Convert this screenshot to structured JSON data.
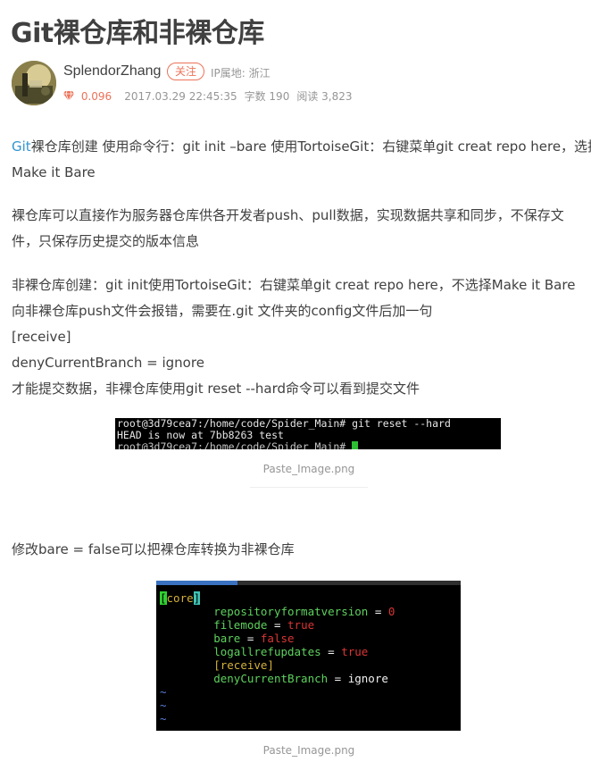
{
  "article": {
    "title": "Git裸仓库和非裸仓库",
    "author": "SplendorZhang",
    "follow_label": "关注",
    "ip_location": "IP属地: 浙江",
    "score": "0.096",
    "date": "2017.03.29 22:45:35",
    "word_count": "字数 190",
    "read_count": "阅读 3,823"
  },
  "content": {
    "p1_link": "Git",
    "p1_line1": "裸仓库创建 使用命令行：git init –bare 使用TortoiseGit：右键菜单git creat repo here，选择",
    "p1_line2": "Make it Bare",
    "p2_line1": "裸仓库可以直接作为服务器仓库供各开发者push、pull数据，实现数据共享和同步，不保存文",
    "p2_line2": "件，只保存历史提交的版本信息",
    "p3_lines": [
      "非裸仓库创建：git init使用TortoiseGit：右键菜单git creat repo here，不选择Make it Bare",
      "向非裸仓库push文件会报错，需要在.git 文件夹的config文件后加一句",
      "[receive]",
      "denyCurrentBranch = ignore",
      "才能提交数据，非裸仓库使用git reset --hard命令可以看到提交文件"
    ],
    "image1_caption": "Paste_Image.png",
    "p4": "修改bare = false可以把裸仓库转换为非裸仓库",
    "image2_caption": "Paste_Image.png"
  },
  "terminal1": {
    "line1": "root@3d79cea7:/home/code/Spider_Main# git reset --hard",
    "line2": "HEAD is now at 7bb8263 test",
    "line3": "root@3d79cea7:/home/code/Spider_Main# "
  },
  "terminal2": {
    "bracket_open": "[",
    "section": "core",
    "bracket_close": "]",
    "k1": "repositoryformatversion",
    "eq1": " = ",
    "v1": "0",
    "k2": "filemode",
    "eq2": " = ",
    "v2": "true",
    "k3": "bare",
    "eq3": " = ",
    "v3": "false",
    "k4": "logallrefupdates",
    "eq4": " = ",
    "v4": "true",
    "k5": "[receive]",
    "k6": "denyCurrentBranch",
    "eq6": " = ",
    "v6": "ignore",
    "tilde": "~"
  },
  "colors": {
    "accent": "#ec7259",
    "link": "#3194d0",
    "text": "#404040",
    "muted": "#969696"
  },
  "icons": {
    "score": "diamond-icon"
  }
}
